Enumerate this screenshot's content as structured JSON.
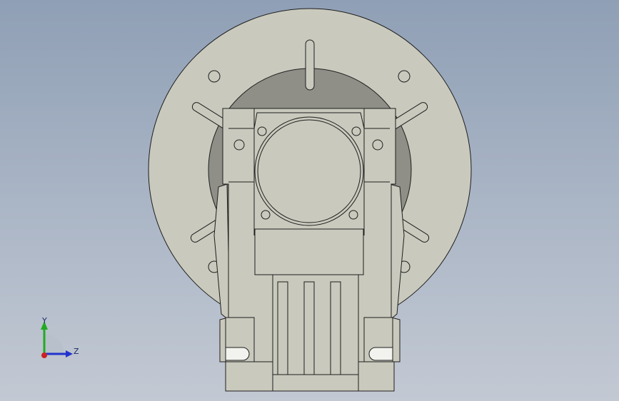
{
  "viewport": {
    "background_top": "#8f9fb5",
    "background_bottom": "#c3c9d3"
  },
  "model": {
    "name_icon": "worm-gear-reducer-front-view",
    "fill_color": "#c9c9bd",
    "edge_color": "#1e1e1e",
    "shade_color": "#8c8c84"
  },
  "triad": {
    "x_label": "",
    "y_label": "Y",
    "z_label": "Z",
    "y_color": "#22aa22",
    "z_color": "#2233cc",
    "origin_color": "#cc2222"
  }
}
